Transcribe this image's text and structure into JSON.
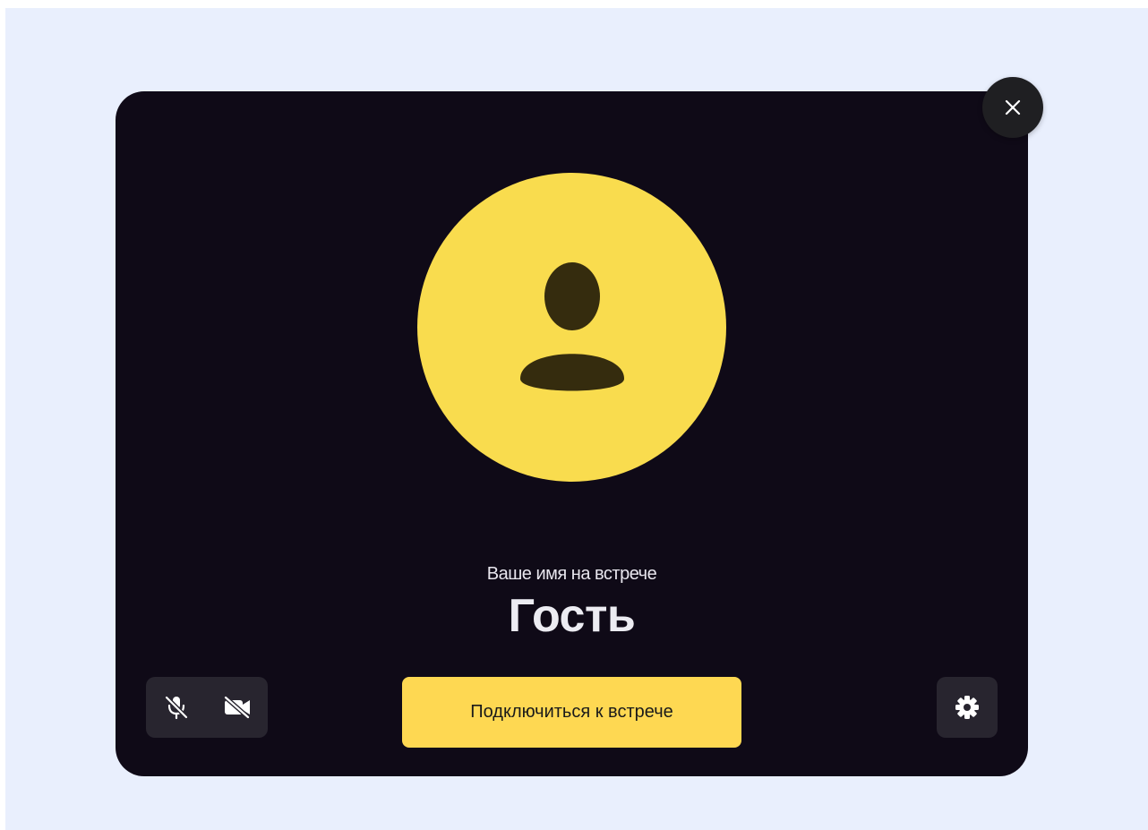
{
  "close_icon": "close-icon",
  "avatar": {
    "icon": "person-icon",
    "color": "#f9dc4e"
  },
  "name": {
    "caption": "Ваше имя на встрече",
    "value": "Гость"
  },
  "media": {
    "mic_icon": "mic-off-icon",
    "camera_icon": "camera-off-icon"
  },
  "join_button": {
    "label": "Подключиться к встрече",
    "color": "#fed852"
  },
  "settings_icon": "gear-icon",
  "colors": {
    "card_bg": "#0f0a17",
    "page_bg": "#e9effd"
  }
}
